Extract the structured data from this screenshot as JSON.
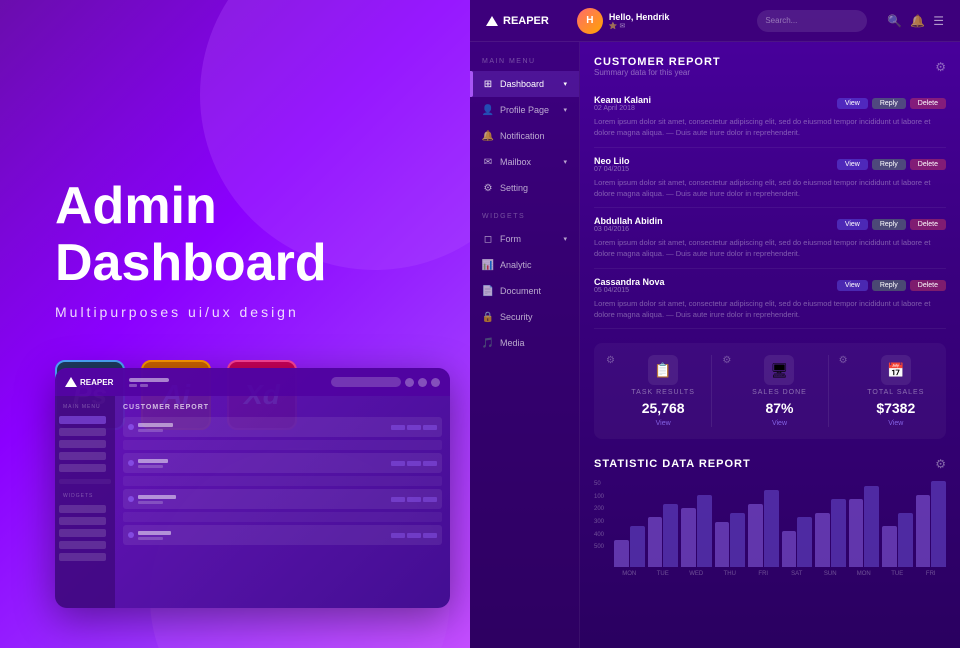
{
  "left": {
    "title_line1": "Admin",
    "title_line2": "Dashboard",
    "subtitle": "Multipurposes ui/ux design",
    "tools": [
      {
        "id": "ps",
        "label": "Ps",
        "class": "tool-ps"
      },
      {
        "id": "ai",
        "label": "Ai",
        "class": "tool-ai"
      },
      {
        "id": "xd",
        "label": "Xd",
        "class": "tool-xd"
      }
    ]
  },
  "dashboard": {
    "logo": "REAPER",
    "user": {
      "name": "Hello, Hendrik",
      "role": "⭐ ✉",
      "initials": "H"
    },
    "search_placeholder": "Search...",
    "nav": {
      "main_label": "MAIN MENU",
      "items": [
        {
          "icon": "⊞",
          "label": "Dashboard",
          "has_arrow": true,
          "active": true
        },
        {
          "icon": "👤",
          "label": "Profile Page",
          "has_arrow": true
        },
        {
          "icon": "🔔",
          "label": "Notification"
        },
        {
          "icon": "✉",
          "label": "Mailbox",
          "has_arrow": true
        },
        {
          "icon": "⚙",
          "label": "Setting"
        }
      ],
      "widget_label": "WIDGETS",
      "widgets": [
        {
          "icon": "◻",
          "label": "Form",
          "has_arrow": true
        },
        {
          "icon": "📊",
          "label": "Analytic"
        },
        {
          "icon": "📄",
          "label": "Document"
        },
        {
          "icon": "🔒",
          "label": "Security"
        },
        {
          "icon": "🎵",
          "label": "Media"
        }
      ]
    },
    "customer_report": {
      "title": "CUSTOMER REPORT",
      "subtitle": "Summary data for this year",
      "customers": [
        {
          "name": "Keanu Kalani",
          "date": "02 April 2018",
          "text": "Lorem ipsum dolor sit amet, consectetur adipiscing elit, sed do eiusmod tempor incididunt ut labore et dolore magna aliqua. — Duis aute irure dolor in reprehenderit."
        },
        {
          "name": "Neo Lilo",
          "date": "07 04/2015",
          "text": "Lorem ipsum dolor sit amet, consectetur adipiscing elit, sed do eiusmod tempor incididunt ut labore et dolore magna aliqua. — Duis aute irure dolor in reprehenderit."
        },
        {
          "name": "Abdullah Abidin",
          "date": "03 04/2016",
          "text": "Lorem ipsum dolor sit amet, consectetur adipiscing elit, sed do eiusmod tempor incididunt ut labore et dolore magna aliqua. — Duis aute irure dolor in reprehenderit."
        },
        {
          "name": "Cassandra Nova",
          "date": "05 04/2015",
          "text": "Lorem ipsum dolor sit amet, consectetur adipiscing elit, sed do eiusmod tempor incididunt ut labore et dolore magna aliqua. — Duis aute irure dolor in reprehenderit."
        }
      ],
      "btn_view": "View",
      "btn_reply": "Reply",
      "btn_delete": "Delete"
    },
    "stats": [
      {
        "label": "TASK RESULTS",
        "value": "25,768",
        "link": "View",
        "icon": "📋"
      },
      {
        "label": "SALES DONE",
        "value": "87%",
        "link": "View",
        "icon": "🖥"
      },
      {
        "label": "TOTAL SALES",
        "value": "$7382",
        "link": "View",
        "icon": "📅"
      }
    ],
    "chart": {
      "title": "STATISTIC DATA REPORT",
      "y_labels": [
        "500",
        "400",
        "300",
        "200",
        "100",
        "50"
      ],
      "x_labels": [
        "MON",
        "TUE",
        "WED",
        "THU",
        "FRI",
        "SAT",
        "SUN",
        "MON",
        "TUE",
        "FRI"
      ],
      "bars": [
        [
          30,
          45
        ],
        [
          55,
          70
        ],
        [
          65,
          80
        ],
        [
          50,
          60
        ],
        [
          70,
          85
        ],
        [
          40,
          55
        ],
        [
          60,
          75
        ],
        [
          75,
          90
        ],
        [
          45,
          60
        ],
        [
          80,
          95
        ]
      ]
    }
  }
}
